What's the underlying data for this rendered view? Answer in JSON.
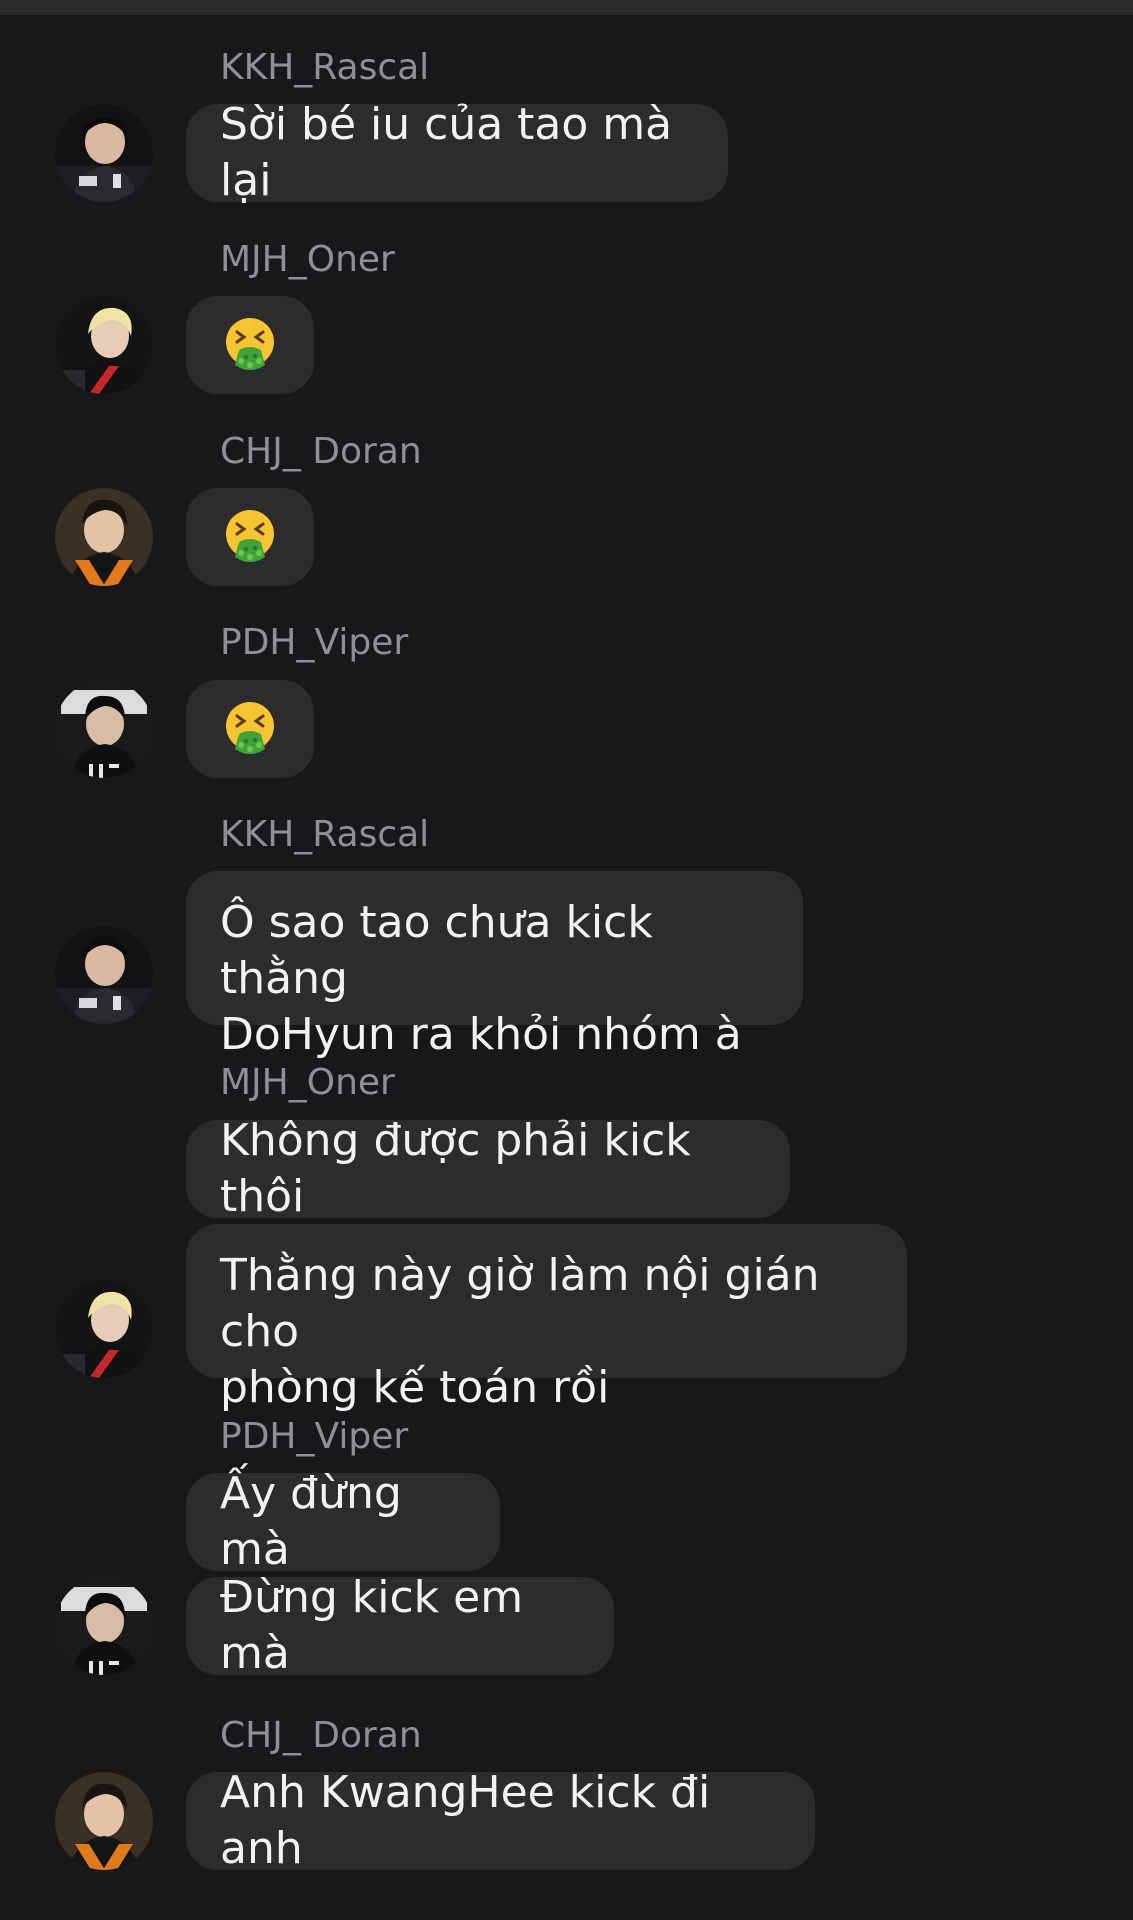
{
  "chat": {
    "messages": [
      {
        "sender": "KKH_Rascal",
        "lines": [
          "Sời bé iu của tao mà lại"
        ]
      },
      {
        "sender": "MJH_Oner",
        "emoji": "face-vomiting"
      },
      {
        "sender": "CHJ_ Doran",
        "emoji": "face-vomiting"
      },
      {
        "sender": "PDH_Viper",
        "emoji": "face-vomiting"
      },
      {
        "sender": "KKH_Rascal",
        "lines": [
          "Ô sao tao chưa kick thằng",
          "DoHyun ra khỏi nhóm à"
        ]
      },
      {
        "sender": "MJH_Oner",
        "lines": [
          "Không được phải kick thôi"
        ]
      },
      {
        "lines": [
          "Thằng này giờ làm nội gián cho",
          "phòng kế toán rồi"
        ]
      },
      {
        "sender": "PDH_Viper",
        "lines": [
          "Ấy đừng mà"
        ]
      },
      {
        "lines": [
          "Đừng kick em mà"
        ]
      },
      {
        "sender": "CHJ_ Doran",
        "lines": [
          "Anh KwangHee kick đi anh"
        ]
      }
    ]
  },
  "colors": {
    "background": "#18181a",
    "bubble": "#2c2c2f",
    "message_text": "#f2f2f4",
    "sender_text": "#8f8f95",
    "vomit_face": "#f7c531",
    "vomit_green": "#3fa33a"
  }
}
